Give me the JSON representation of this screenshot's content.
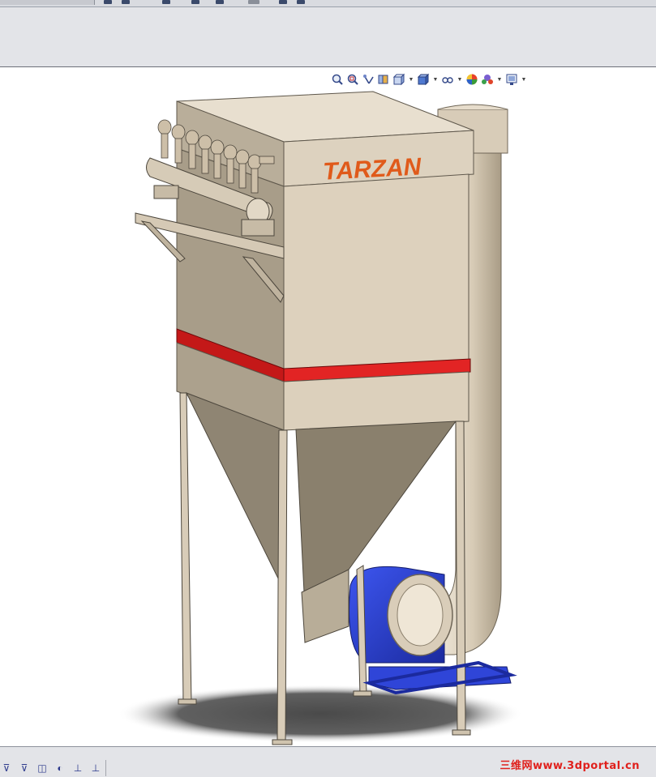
{
  "window": {
    "app": "SolidWorks"
  },
  "heads_up_toolbar": {
    "buttons": [
      {
        "icon": "zoom-to-fit-icon"
      },
      {
        "icon": "zoom-to-area-icon"
      },
      {
        "icon": "previous-view-icon"
      },
      {
        "icon": "section-view-icon"
      },
      {
        "icon": "view-orientation-icon",
        "dropdown": true
      },
      {
        "icon": "display-style-icon",
        "dropdown": true
      },
      {
        "icon": "hide-show-items-icon",
        "dropdown": true
      },
      {
        "icon": "edit-appearance-icon"
      },
      {
        "icon": "apply-scene-icon",
        "dropdown": true
      },
      {
        "icon": "view-settings-icon",
        "dropdown": true
      }
    ]
  },
  "model": {
    "logo_text": "TARZAN",
    "colors": {
      "body": "#d4c8b4",
      "band": "#d91f1f",
      "fan": "#2a3fd6"
    }
  },
  "status_bar": {
    "icons": [
      "filter-icon",
      "filter-edges-icon",
      "filter-faces-icon",
      "filter-vertices-icon",
      "filter-sketch-icon",
      "filter-points-icon"
    ]
  },
  "watermark": "三维网www.3dportal.cn"
}
